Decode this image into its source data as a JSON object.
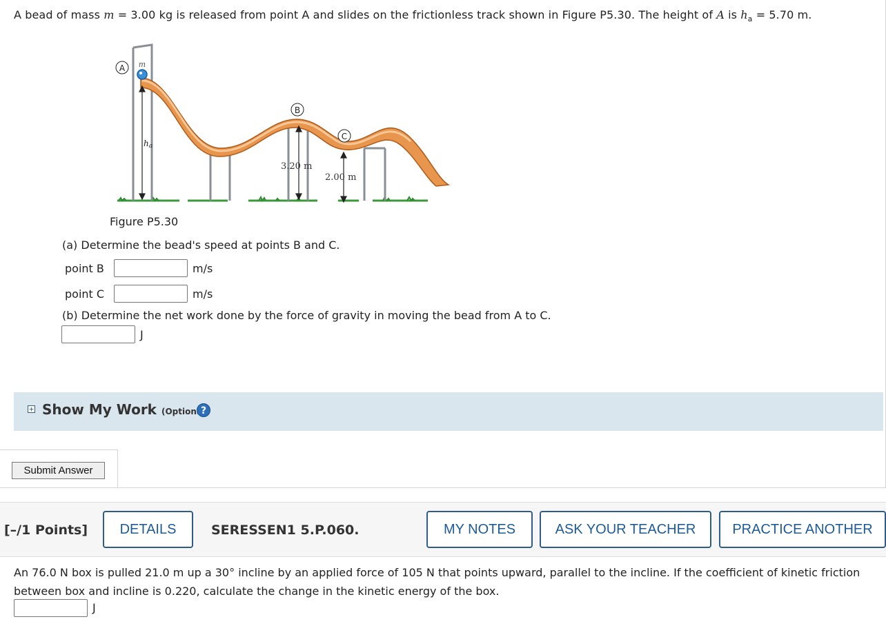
{
  "question1": {
    "intro_a": "A bead of mass ",
    "var_m": "m",
    "intro_b": " = ",
    "mass": "3.00",
    "intro_c": " kg is released from point A and slides on the frictionless track shown in Figure P5.30. The height of ",
    "var_A": "A",
    "intro_d": " is ",
    "var_h": "h",
    "var_h_sub": "a",
    "intro_e": " = ",
    "height": "5.70",
    "intro_f": " m.",
    "figure": {
      "label_A": "A",
      "label_B": "B",
      "label_C": "C",
      "label_m": "m",
      "label_ha": "h",
      "label_ha_sub": "a",
      "label_320": "3.20 m",
      "label_200": "2.00 m"
    },
    "caption": "Figure P5.30",
    "part_a": "(a) Determine the bead's speed at points B and C.",
    "point_b_label": "point B",
    "point_b_value": "",
    "point_b_unit": "m/s",
    "point_c_label": "point C",
    "point_c_value": "",
    "point_c_unit": "m/s",
    "part_b": "(b) Determine the net work done by the force of gravity in moving the bead from A to C.",
    "work_value": "",
    "work_unit": "J",
    "show_work": "Show My Work",
    "show_work_optional": "(Optional)",
    "help": "?",
    "submit": "Submit Answer"
  },
  "question2": {
    "points": "[–/1 Points]",
    "details": "DETAILS",
    "code": "SERESSEN1 5.P.060.",
    "my_notes": "MY NOTES",
    "ask_teacher": "ASK YOUR TEACHER",
    "practice": "PRACTICE ANOTHER",
    "text_a": "An ",
    "force": "76.0",
    "text_b": " N box is pulled ",
    "distance": "21.0",
    "text_c": " m up a 30° incline by an applied force of ",
    "applied": "105",
    "text_d": " N that points upward, parallel to the incline. If the coefficient of kinetic friction between box and incline is 0.220, calculate the change in the kinetic energy of the box.",
    "answer_value": "",
    "answer_unit": "J"
  },
  "colors": {
    "track": "#e8954e",
    "track_light": "#f2b880",
    "grass": "#3a9a3a",
    "post": "#8a8f96",
    "bead": "#3b8fd9",
    "link": "#1d5a96",
    "work_bar": "#dae6ee"
  }
}
